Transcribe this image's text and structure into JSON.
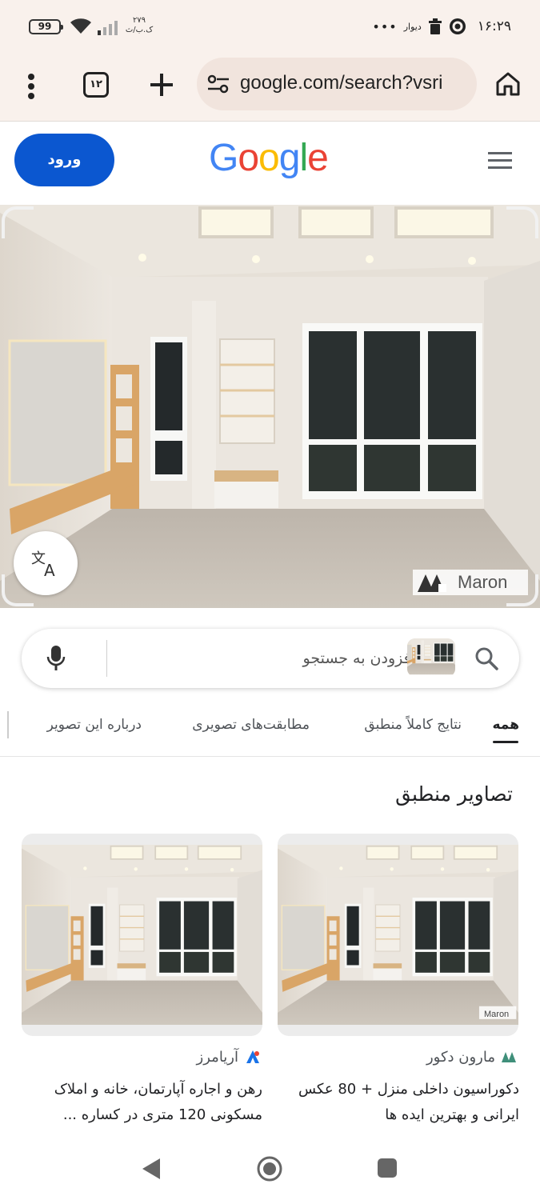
{
  "status_bar": {
    "battery": "99",
    "net_speed_value": "۲۷۹",
    "net_speed_unit": "ک.ب/ث",
    "more": "•••",
    "divar": "دیوار",
    "time": "۱۶:۲۹"
  },
  "browser": {
    "tab_count": "۱۲",
    "url": "google.com/search?vsri"
  },
  "google": {
    "login_label": "ورود",
    "logo_letters": [
      "G",
      "o",
      "o",
      "g",
      "l",
      "e"
    ],
    "logo_colors": [
      "#4285F4",
      "#EA4335",
      "#FBBC05",
      "#4285F4",
      "#34A853",
      "#EA4335"
    ],
    "watermark": "Maron"
  },
  "search": {
    "placeholder": "افزودن به جستجو"
  },
  "tabs": [
    {
      "label": "همه",
      "active": true
    },
    {
      "label": "نتایج کاملاً منطبق",
      "active": false
    },
    {
      "label": "مطابقت‌های تصویری",
      "active": false
    },
    {
      "label": "درباره این تصویر",
      "active": false
    }
  ],
  "results": {
    "section_title": "تصاویر منطبق",
    "cards": [
      {
        "source": "مارون دکور",
        "title": "دکوراسیون داخلی منزل + 80 عکس ایرانی و بهترین ایده ها",
        "watermark": "Maron"
      },
      {
        "source": "آریامرز",
        "title": "رهن و اجاره آپارتمان، خانه و املاک مسکونی 120 متری در کساره ..."
      }
    ]
  },
  "colors": {
    "accent": "#0b57d0",
    "toolbar_bg": "#f9f1ec"
  }
}
